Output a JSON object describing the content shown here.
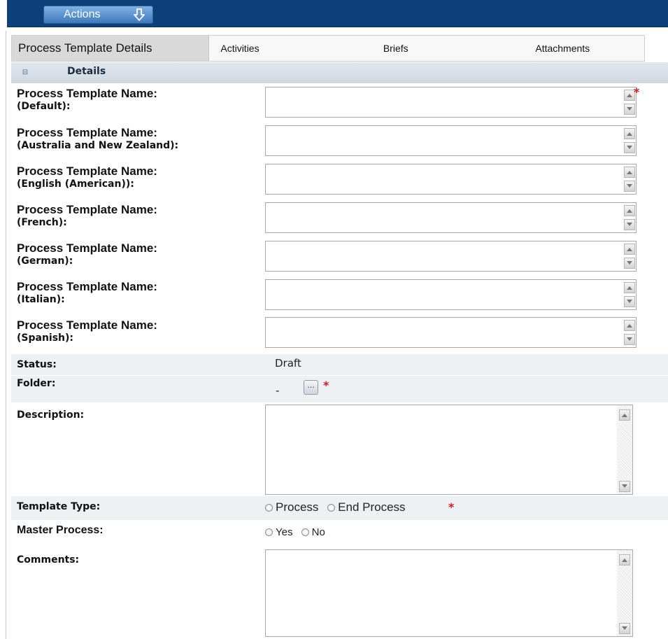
{
  "toolbar": {
    "actions_label": "Actions",
    "actions_icon": "arrow-down-icon",
    "bar_color": "#0d3f78"
  },
  "tabs": [
    {
      "label": "Process Template Details",
      "active": true
    },
    {
      "label": "Activities",
      "active": false
    },
    {
      "label": "Briefs",
      "active": false
    },
    {
      "label": "Attachments",
      "active": false
    }
  ],
  "section": {
    "title": "Details",
    "collapse_icon": "collapse-icon"
  },
  "name_fields": [
    {
      "label_main": "Process Template Name:",
      "label_locale": "(Default):",
      "value": "",
      "required": true
    },
    {
      "label_main": "Process Template Name:",
      "label_locale": "(Australia and New Zealand):",
      "value": "",
      "required": false
    },
    {
      "label_main": "Process Template Name:",
      "label_locale": "(English (American)):",
      "value": "",
      "required": false
    },
    {
      "label_main": "Process Template Name:",
      "label_locale": "(French):",
      "value": "",
      "required": false
    },
    {
      "label_main": "Process Template Name:",
      "label_locale": "(German):",
      "value": "",
      "required": false
    },
    {
      "label_main": "Process Template Name:",
      "label_locale": "(Italian):",
      "value": "",
      "required": false
    },
    {
      "label_main": "Process Template Name:",
      "label_locale": "(Spanish):",
      "value": "",
      "required": false
    }
  ],
  "status": {
    "label": "Status:",
    "value": "Draft"
  },
  "folder": {
    "label": "Folder:",
    "value": "-",
    "browse_label": "...",
    "required": true
  },
  "description": {
    "label": "Description:",
    "value": ""
  },
  "template_type": {
    "label": "Template Type:",
    "options": [
      "Process",
      "End Process"
    ],
    "selected": null,
    "required": true
  },
  "master_process": {
    "label": "Master Process:",
    "options": [
      "Yes",
      "No"
    ],
    "selected": null
  },
  "comments": {
    "label": "Comments:",
    "value": ""
  },
  "required_marker": "*",
  "colors": {
    "required": "#d21d1d",
    "section_header": "#d8e0e9",
    "row_shade": "#eef1f4"
  }
}
